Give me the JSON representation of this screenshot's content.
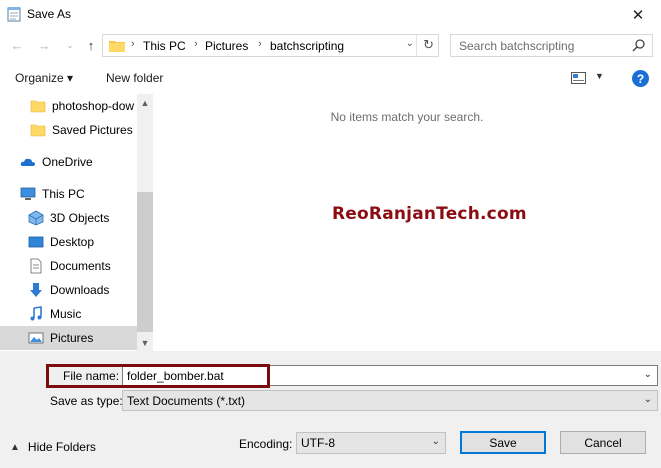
{
  "window": {
    "title": "Save As",
    "close_icon": "close-icon"
  },
  "nav": {
    "breadcrumb": [
      "This PC",
      "Pictures",
      "batchscripting"
    ],
    "search_placeholder": "Search batchscripting"
  },
  "toolbar": {
    "organize": "Organize ▾",
    "new_folder": "New folder",
    "help": "?"
  },
  "sidebar": {
    "items": [
      {
        "label": "photoshop-dow",
        "icon": "folder-icon"
      },
      {
        "label": "Saved Pictures",
        "icon": "folder-icon"
      },
      {
        "label": "OneDrive",
        "icon": "cloud-icon"
      },
      {
        "label": "This PC",
        "icon": "computer-icon"
      },
      {
        "label": "3D Objects",
        "icon": "cube-icon"
      },
      {
        "label": "Desktop",
        "icon": "desktop-icon"
      },
      {
        "label": "Documents",
        "icon": "document-icon"
      },
      {
        "label": "Downloads",
        "icon": "download-icon"
      },
      {
        "label": "Music",
        "icon": "music-icon"
      },
      {
        "label": "Pictures",
        "icon": "pictures-icon",
        "selected": true
      }
    ]
  },
  "content": {
    "empty_message": "No items match your search.",
    "watermark": "ReoRanjanTech.com"
  },
  "form": {
    "file_name_label": "File name:",
    "file_name_value": "folder_bomber.bat",
    "save_as_type_label": "Save as type:",
    "save_as_type_value": "Text Documents (*.txt)",
    "encoding_label": "Encoding:",
    "encoding_value": "UTF-8",
    "save_button": "Save",
    "cancel_button": "Cancel",
    "hide_folders": "Hide Folders"
  },
  "colors": {
    "accent": "#0078d7",
    "highlight_box": "#7a0c10",
    "watermark": "#8b0d12"
  }
}
